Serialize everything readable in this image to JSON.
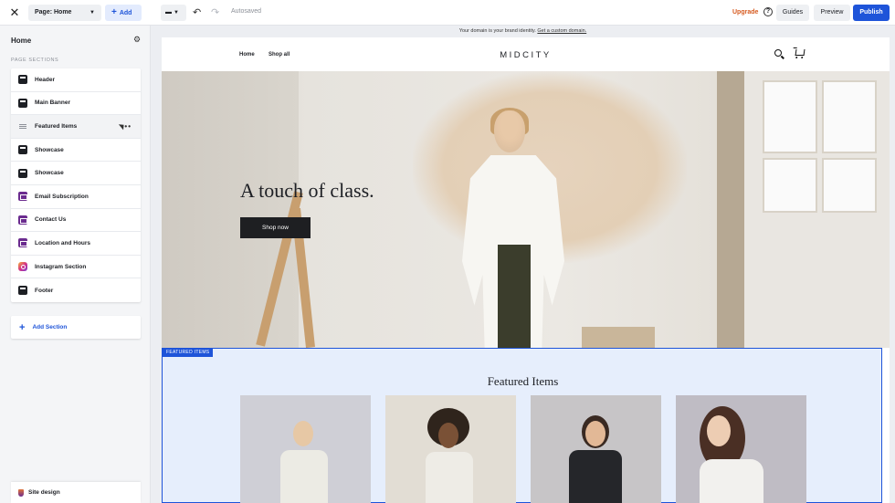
{
  "topbar": {
    "close_icon": "close-icon",
    "page_select": "Page: Home",
    "add_label": "Add",
    "autosaved": "Autosaved",
    "upgrade": "Upgrade",
    "guides": "Guides",
    "preview": "Preview",
    "publish": "Publish"
  },
  "sidebar": {
    "title": "Home",
    "section_label": "PAGE SECTIONS",
    "items": [
      {
        "label": "Header",
        "icon": "header-icon"
      },
      {
        "label": "Main Banner",
        "icon": "banner-icon"
      },
      {
        "label": "Featured Items",
        "icon": "drag-handle-icon"
      },
      {
        "label": "Showcase",
        "icon": "showcase-icon"
      },
      {
        "label": "Showcase",
        "icon": "showcase-icon"
      },
      {
        "label": "Email Subscription",
        "icon": "email-icon"
      },
      {
        "label": "Contact Us",
        "icon": "contact-icon"
      },
      {
        "label": "Location and Hours",
        "icon": "location-icon"
      },
      {
        "label": "Instagram Section",
        "icon": "instagram-icon"
      },
      {
        "label": "Footer",
        "icon": "footer-icon"
      }
    ],
    "add_section": "Add Section",
    "site_design": "Site design"
  },
  "canvas": {
    "domain_notice": "Your domain is your brand identity.",
    "domain_link": "Get a custom domain."
  },
  "site": {
    "nav": {
      "home": "Home",
      "shop_all": "Shop all"
    },
    "brand": "MIDCITY",
    "hero": {
      "title": "A touch of class.",
      "button": "Shop now"
    },
    "featured": {
      "tag": "FEATURED ITEMS",
      "title": "Featured Items"
    }
  },
  "colors": {
    "accent": "#1e54d9",
    "upgrade": "#d65a1f",
    "featured_bg": "#e6eefc"
  }
}
